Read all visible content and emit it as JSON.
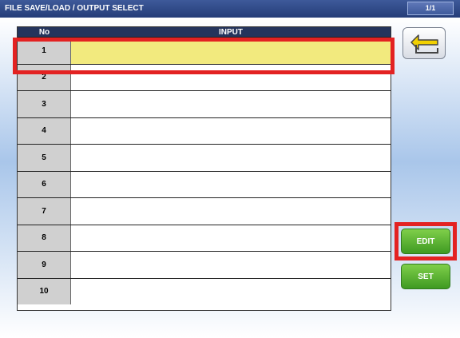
{
  "header": {
    "title": "FILE SAVE/LOAD / OUTPUT SELECT",
    "page": "1/1"
  },
  "table": {
    "columns": {
      "no": "No",
      "input": "INPUT"
    },
    "rows": [
      {
        "no": "1",
        "input": ""
      },
      {
        "no": "2",
        "input": ""
      },
      {
        "no": "3",
        "input": ""
      },
      {
        "no": "4",
        "input": ""
      },
      {
        "no": "5",
        "input": ""
      },
      {
        "no": "6",
        "input": ""
      },
      {
        "no": "7",
        "input": ""
      },
      {
        "no": "8",
        "input": ""
      },
      {
        "no": "9",
        "input": ""
      },
      {
        "no": "10",
        "input": ""
      }
    ],
    "selected_row": 1
  },
  "buttons": {
    "back_icon": "return-arrow-icon",
    "edit": "EDIT",
    "set": "SET"
  },
  "colors": {
    "title_bar": "#2c4584",
    "selected_row": "#f2ea7e",
    "highlight": "#e32222",
    "green_button": "#4fa82c"
  }
}
